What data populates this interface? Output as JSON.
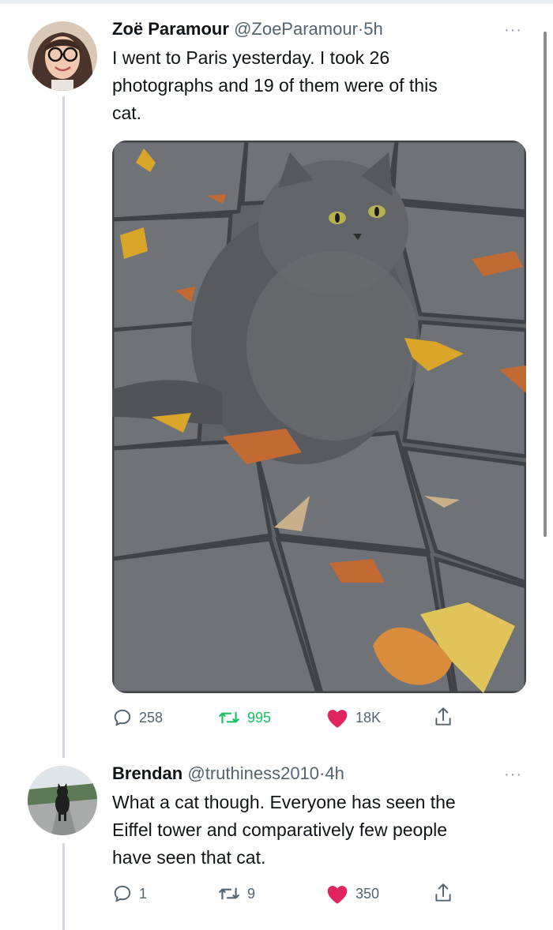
{
  "tweets": [
    {
      "author": "Zoë Paramour",
      "handle": "@ZoeParamour",
      "separator": "·",
      "time": "5h",
      "text_lines": [
        "I went to Paris yesterday. I took 26",
        "photographs and 19 of them were of this",
        "cat."
      ],
      "more_label": "···",
      "replies": "258",
      "retweets": "995",
      "likes": "18K",
      "colors": {
        "retweet": "#17bf63",
        "like": "#e0245e"
      },
      "media_icon": "cat-photo"
    },
    {
      "author": "Brendan",
      "handle": "@truthiness2010",
      "separator": "·",
      "time": "4h",
      "text_lines": [
        "What a cat though. Everyone has seen the",
        "Eiffel tower and comparatively few people",
        "have seen that cat."
      ],
      "more_label": "···",
      "replies": "1",
      "retweets": "9",
      "likes": "350"
    }
  ]
}
